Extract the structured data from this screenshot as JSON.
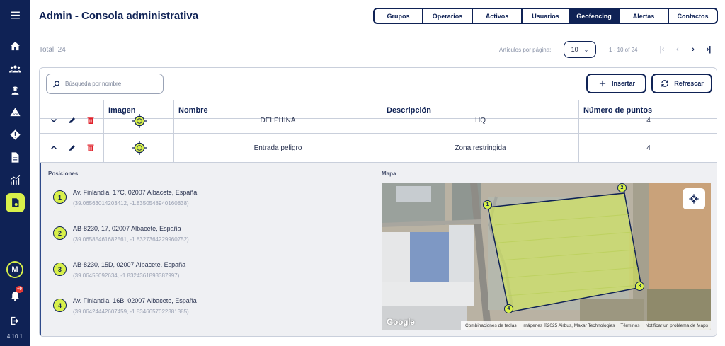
{
  "app": {
    "title": "Admin - Consola administrativa",
    "version": "4.10.1"
  },
  "sidebar": {
    "items": [
      {
        "icon": "menu-icon"
      },
      {
        "icon": "home-icon"
      },
      {
        "icon": "groups-icon"
      },
      {
        "icon": "operator-icon"
      },
      {
        "icon": "sos-icon"
      },
      {
        "icon": "alert-icon"
      },
      {
        "icon": "document-icon"
      },
      {
        "icon": "analytics-icon"
      },
      {
        "icon": "geofence-icon",
        "active": true
      }
    ],
    "avatar_initial": "M",
    "notification_count": "+9",
    "accent_color": "#d8f04a",
    "background_color": "#0f2255"
  },
  "tabs": [
    {
      "label": "Grupos"
    },
    {
      "label": "Operarios"
    },
    {
      "label": "Activos"
    },
    {
      "label": "Usuarios"
    },
    {
      "label": "Geofencing",
      "active": true
    },
    {
      "label": "Alertas"
    },
    {
      "label": "Contactos"
    }
  ],
  "toolbar": {
    "total": "Total: 24",
    "per_page_label": "Artículos por página:",
    "per_page_value": "10",
    "range": "1 - 10 of 24",
    "search_placeholder": "Búsqueda por nombre",
    "insert_label": "Insertar",
    "refresh_label": "Refrescar"
  },
  "table": {
    "headers": {
      "image": "Imagen",
      "name": "Nombre",
      "description": "Descripción",
      "points": "Número de puntos"
    },
    "rows": [
      {
        "name": "DELPHINA",
        "description": "HQ",
        "points": "4",
        "expanded": false
      },
      {
        "name": "Entrada peligro",
        "description": "Zona restringida",
        "points": "4",
        "expanded": true
      }
    ]
  },
  "detail": {
    "positions_label": "Posiciones",
    "map_label": "Mapa",
    "positions": [
      {
        "num": "1",
        "address": "Av. Finlandia, 17C, 02007 Albacete, España",
        "coords": "(39.06563014203412, -1.8350548940160838)"
      },
      {
        "num": "2",
        "address": "AB-8230, 17, 02007 Albacete, España",
        "coords": "(39.06585461682561, -1.8327364229960752)"
      },
      {
        "num": "3",
        "address": "AB-8230, 15D, 02007 Albacete, España",
        "coords": "(39.06455092634, -1.8324361893387997)"
      },
      {
        "num": "4",
        "address": "Av. Finlandia, 16B, 02007 Albacete, España",
        "coords": "(39.06424442607459, -1.8346657022381385)"
      }
    ],
    "map": {
      "logo": "Google",
      "attribution": [
        "Combinaciones de teclas",
        "Imágenes ©2025 Airbus, Maxar Technologies",
        "Términos",
        "Notificar un problema de Maps"
      ]
    }
  }
}
